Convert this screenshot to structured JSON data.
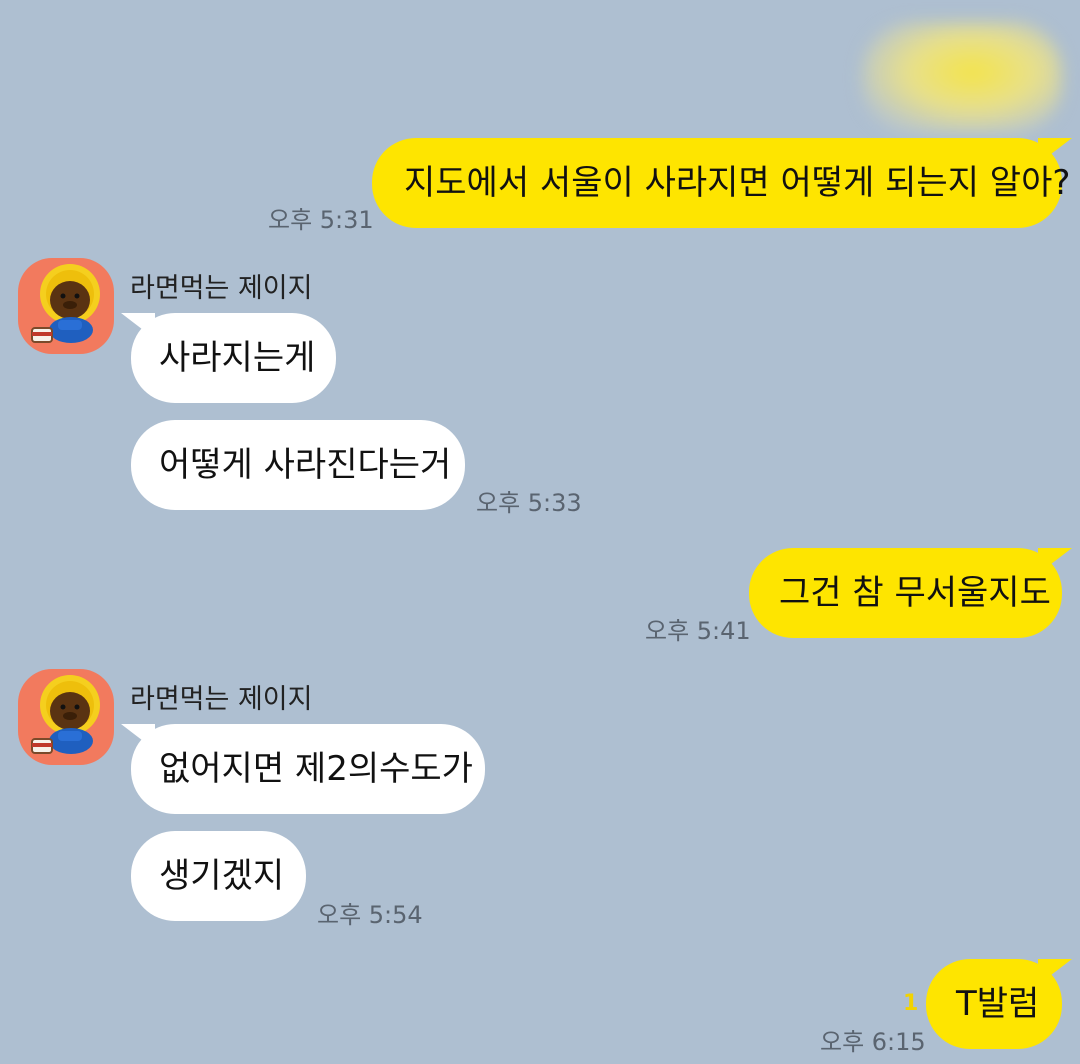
{
  "chat": {
    "messages": [
      {
        "id": "m1",
        "from": "me",
        "text": "지도에서 서울이 사라지면 어떻게 되는지 알아?",
        "time": "오후 5:31"
      },
      {
        "id": "m2",
        "from": "other",
        "sender": "라면먹는 제이지",
        "text": "사라지는게"
      },
      {
        "id": "m3",
        "from": "other",
        "text": "어떻게 사라진다는거",
        "time": "오후 5:33"
      },
      {
        "id": "m4",
        "from": "me",
        "text": "그건 참 무서울지도",
        "time": "오후 5:41"
      },
      {
        "id": "m5",
        "from": "other",
        "sender": "라면먹는 제이지",
        "text": "없어지면 제2의수도가"
      },
      {
        "id": "m6",
        "from": "other",
        "text": "생기겠지",
        "time": "오후 5:54"
      },
      {
        "id": "m7",
        "from": "me",
        "text": "T발럼",
        "time": "오후 6:15",
        "unread": "1"
      }
    ]
  },
  "colors": {
    "background": "#aebfd1",
    "my_bubble": "#fee500",
    "other_bubble": "#ffffff",
    "avatar_bg": "#f27a5e",
    "unread": "#f2d300"
  },
  "icons": {
    "avatar": "ryan-jay-g-character-icon"
  }
}
